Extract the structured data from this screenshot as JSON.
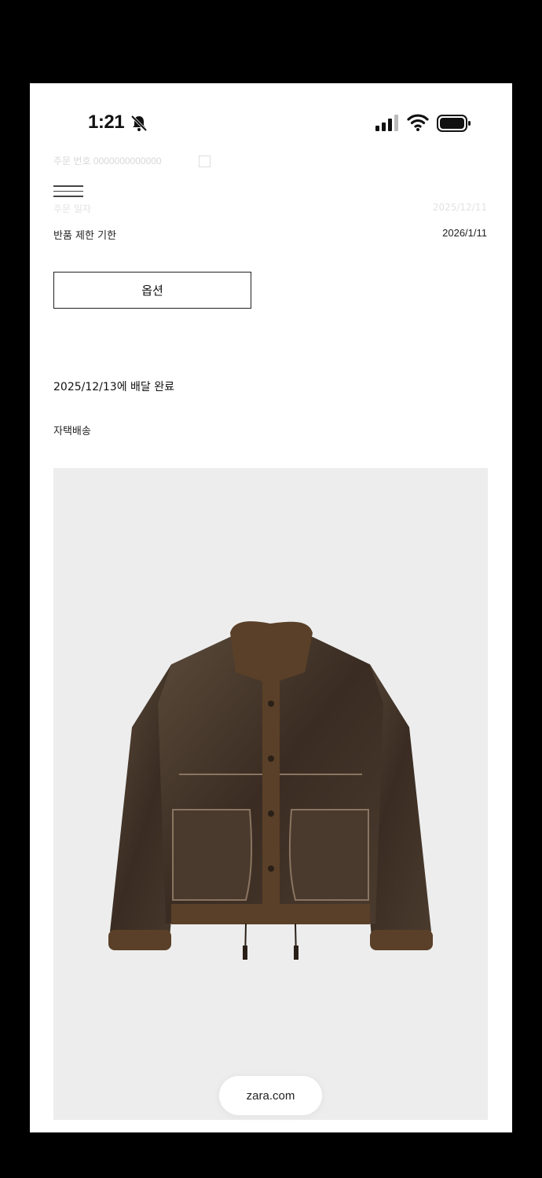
{
  "status_bar": {
    "time": "1:21",
    "icons": [
      "bell-off-icon",
      "cellular-signal-icon",
      "wifi-icon",
      "battery-icon"
    ]
  },
  "faded_rows": {
    "row1": "주문 번호 0000000000000",
    "row2_label": "주문 일자",
    "row2_value": "2025/12/11"
  },
  "order_info": {
    "return_label": "반품 제한 기한",
    "return_date": "2026/1/11"
  },
  "options_button": {
    "label": "옵션"
  },
  "delivery": {
    "status": "2025/12/13에 배달 완료",
    "method": "자택배송"
  },
  "product": {
    "image": "brown-shearling-leather-jacket"
  },
  "browser": {
    "url": "zara.com"
  },
  "colors": {
    "background": "#ffffff",
    "image_background": "#ededed",
    "text": "#111111"
  }
}
